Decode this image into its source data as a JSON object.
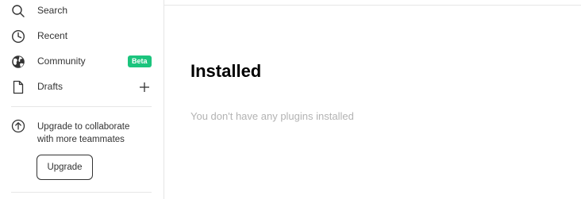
{
  "sidebar": {
    "nav": {
      "search": {
        "label": "Search",
        "icon": "search-icon"
      },
      "recent": {
        "label": "Recent",
        "icon": "clock-icon"
      },
      "community": {
        "label": "Community",
        "icon": "globe-icon",
        "badge": "Beta",
        "badge_color": "#1bc47d"
      },
      "drafts": {
        "label": "Drafts",
        "icon": "file-icon",
        "action_icon": "plus-icon"
      }
    },
    "upgrade": {
      "icon": "arrow-up-circle-icon",
      "line1": "Upgrade to collaborate",
      "line2": "with more teammates",
      "button_label": "Upgrade"
    }
  },
  "main": {
    "title": "Installed",
    "empty_message": "You don't have any plugins installed"
  }
}
